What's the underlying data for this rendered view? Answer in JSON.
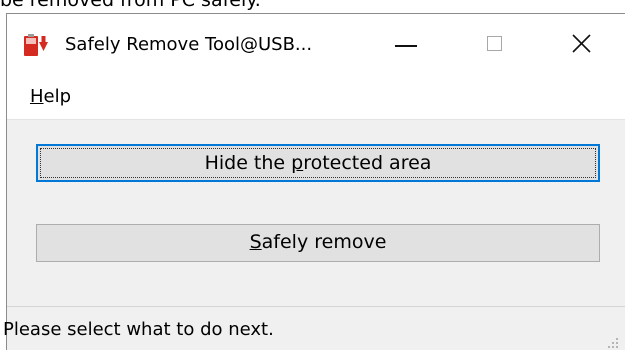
{
  "page_caption": "be removed from PC safely.",
  "window": {
    "title": "Safely Remove Tool@USB...",
    "app_icon": "usb-drive-red-icon",
    "controls": {
      "minimize": "minimize-icon",
      "maximize": "maximize-icon",
      "close": "close-icon"
    }
  },
  "menu": {
    "help": {
      "mnemonic": "H",
      "rest": "elp"
    }
  },
  "buttons": {
    "hide": {
      "before": "Hide the ",
      "mnemonic": "p",
      "after": "rotected area"
    },
    "remove": {
      "before": "",
      "mnemonic": "S",
      "after": "afely remove"
    }
  },
  "status": {
    "text": "Please select what to do next."
  },
  "colors": {
    "focus_border": "#0078d7",
    "button_face": "#e1e1e1",
    "dialog_bg": "#f0f0f0",
    "icon_red": "#d42a1f"
  }
}
